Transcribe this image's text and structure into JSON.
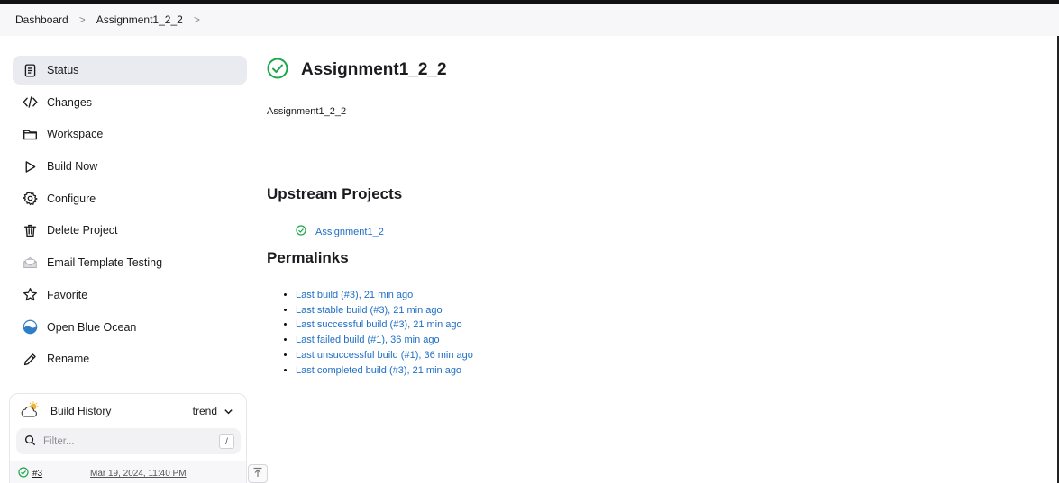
{
  "breadcrumb": {
    "items": [
      "Dashboard",
      "Assignment1_2_2"
    ]
  },
  "sidebar": {
    "items": [
      {
        "label": "Status",
        "icon": "status-document-icon",
        "active": true
      },
      {
        "label": "Changes",
        "icon": "code-icon"
      },
      {
        "label": "Workspace",
        "icon": "folder-icon"
      },
      {
        "label": "Build Now",
        "icon": "play-icon"
      },
      {
        "label": "Configure",
        "icon": "gear-icon"
      },
      {
        "label": "Delete Project",
        "icon": "trash-icon"
      },
      {
        "label": "Email Template Testing",
        "icon": "email-icon"
      },
      {
        "label": "Favorite",
        "icon": "star-icon"
      },
      {
        "label": "Open Blue Ocean",
        "icon": "blue-ocean-icon"
      },
      {
        "label": "Rename",
        "icon": "pencil-icon"
      }
    ]
  },
  "build_history": {
    "title": "Build History",
    "trend_label": "trend",
    "filter_placeholder": "Filter...",
    "filter_shortcut": "/",
    "builds": [
      {
        "number": "#3",
        "date": "Mar 19, 2024, 11:40 PM",
        "status": "success"
      }
    ]
  },
  "main": {
    "title": "Assignment1_2_2",
    "description": "Assignment1_2_2",
    "upstream_heading": "Upstream Projects",
    "upstream_projects": [
      "Assignment1_2"
    ],
    "permalinks_heading": "Permalinks",
    "permalinks": [
      "Last build (#3), 21 min ago",
      "Last stable build (#3), 21 min ago",
      "Last successful build (#3), 21 min ago",
      "Last failed build (#1), 36 min ago",
      "Last unsuccessful build (#1), 36 min ago",
      "Last completed build (#3), 21 min ago"
    ]
  },
  "colors": {
    "success": "#1ea64b",
    "link": "#1f6fc5",
    "active_bg": "#e9ebf0"
  }
}
